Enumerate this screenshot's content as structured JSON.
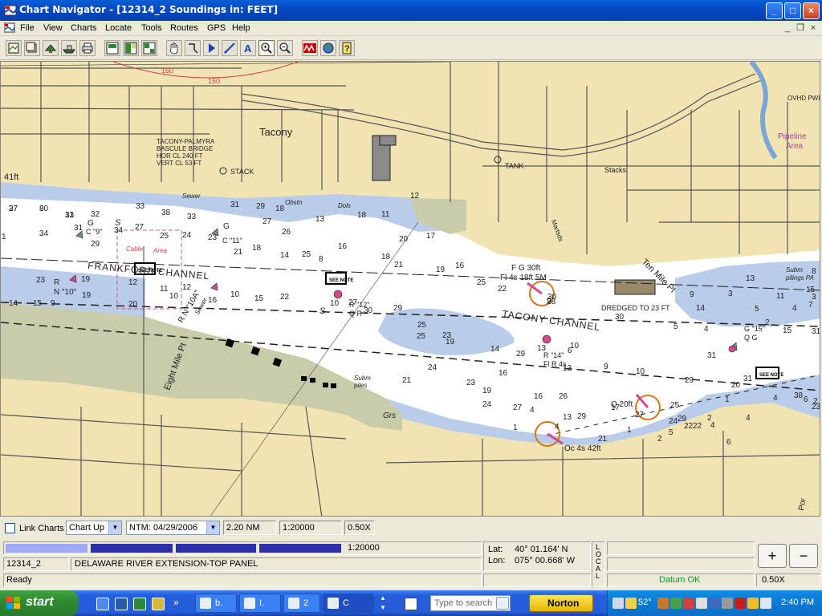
{
  "window": {
    "title": "Chart Navigator - [12314_2 Soundings in: FEET]",
    "min_label": "_",
    "max_label": "□",
    "close_label": "×"
  },
  "menu": {
    "items": [
      "File",
      "View",
      "Charts",
      "Locate",
      "Tools",
      "Routes",
      "GPS",
      "Help"
    ],
    "mdi_min": "_",
    "mdi_restore": "❐",
    "mdi_close": "×"
  },
  "toolbar": {
    "buttons": [
      "open-chart-icon",
      "chart-catalog-icon",
      "chart-info-icon",
      "ship-icon",
      "print-icon",
      "overview-icon",
      "split-view-icon",
      "grid-icon",
      "pan-hand-icon",
      "zoom-box-icon",
      "waypoint-icon",
      "route-line-icon",
      "text-tool-icon",
      "zoom-in-icon",
      "zoom-out-icon",
      "tide-icon",
      "web-icon",
      "help-icon"
    ],
    "pressed": "zoom-in-icon"
  },
  "map": {
    "soundings": [
      {
        "t": "27"
      },
      {
        "t": "30"
      },
      {
        "t": "31"
      },
      {
        "t": "32"
      },
      {
        "t": "33"
      },
      {
        "t": "38"
      },
      {
        "t": "33"
      },
      {
        "t": "31"
      },
      {
        "t": "29"
      },
      {
        "t": "18"
      },
      {
        "t": "13"
      },
      {
        "t": "18"
      },
      {
        "t": "11"
      },
      {
        "t": "12"
      },
      {
        "t": "1"
      },
      {
        "t": "34"
      },
      {
        "t": "31"
      },
      {
        "t": "29"
      },
      {
        "t": "34"
      },
      {
        "t": "27"
      },
      {
        "t": "25"
      },
      {
        "t": "24"
      },
      {
        "t": "23"
      },
      {
        "t": "21"
      },
      {
        "t": "27"
      },
      {
        "t": "26"
      },
      {
        "t": "25"
      },
      {
        "t": "18"
      },
      {
        "t": "14"
      },
      {
        "t": "8"
      },
      {
        "t": "16"
      },
      {
        "t": "18"
      },
      {
        "t": "20"
      },
      {
        "t": "17"
      },
      {
        "t": "21"
      },
      {
        "t": "19"
      },
      {
        "t": "16"
      },
      {
        "t": "25"
      },
      {
        "t": "22"
      },
      {
        "t": "23"
      },
      {
        "t": "19"
      },
      {
        "t": "15"
      },
      {
        "t": "14"
      },
      {
        "t": "9"
      },
      {
        "t": "19"
      },
      {
        "t": "20"
      },
      {
        "t": "12"
      },
      {
        "t": "10"
      },
      {
        "t": "11"
      },
      {
        "t": "12"
      },
      {
        "t": "16"
      },
      {
        "t": "10"
      },
      {
        "t": "15"
      },
      {
        "t": "22"
      },
      {
        "t": "10"
      },
      {
        "t": "27"
      },
      {
        "t": "30"
      },
      {
        "t": "29"
      },
      {
        "t": "25"
      },
      {
        "t": "25"
      },
      {
        "t": "23"
      },
      {
        "t": "19"
      },
      {
        "t": "14"
      },
      {
        "t": "29"
      },
      {
        "t": "16"
      },
      {
        "t": "13"
      },
      {
        "t": "10"
      },
      {
        "t": "13"
      },
      {
        "t": "9"
      },
      {
        "t": "10"
      },
      {
        "t": "17"
      },
      {
        "t": "16"
      },
      {
        "t": "19"
      },
      {
        "t": "21"
      },
      {
        "t": "24"
      },
      {
        "t": "23"
      },
      {
        "t": "24"
      },
      {
        "t": "27"
      },
      {
        "t": "26"
      },
      {
        "t": "29"
      },
      {
        "t": "21"
      },
      {
        "t": "27"
      },
      {
        "t": "25"
      },
      {
        "t": "24"
      },
      {
        "t": "22"
      },
      {
        "t": "2"
      },
      {
        "t": "1"
      },
      {
        "t": "4"
      },
      {
        "t": "4"
      },
      {
        "t": "6"
      },
      {
        "t": "2"
      },
      {
        "t": "23"
      },
      {
        "t": "1"
      },
      {
        "t": "4"
      },
      {
        "t": "2"
      },
      {
        "t": "5"
      },
      {
        "t": "4"
      },
      {
        "t": "28"
      },
      {
        "t": "30"
      },
      {
        "t": "30"
      },
      {
        "t": "5"
      },
      {
        "t": "4"
      },
      {
        "t": "31"
      },
      {
        "t": "20"
      },
      {
        "t": "15"
      },
      {
        "t": "31"
      },
      {
        "t": "29"
      },
      {
        "t": "31"
      },
      {
        "t": "38"
      },
      {
        "t": "29"
      },
      {
        "t": "22"
      },
      {
        "t": "6"
      },
      {
        "t": "13"
      },
      {
        "t": "8"
      },
      {
        "t": "9"
      },
      {
        "t": "3"
      },
      {
        "t": "5"
      },
      {
        "t": "2"
      },
      {
        "t": "11"
      },
      {
        "t": "15"
      },
      {
        "t": "7"
      },
      {
        "t": "3"
      },
      {
        "t": "4"
      },
      {
        "t": "14"
      },
      {
        "t": "13"
      },
      {
        "t": "1"
      },
      {
        "t": "6"
      },
      {
        "t": "9"
      },
      {
        "t": "4"
      },
      {
        "t": "37"
      },
      {
        "t": "8"
      },
      {
        "t": "13"
      }
    ],
    "labels": {
      "tacony": "Tacony",
      "bridge1": "TACONY-PALMYRA",
      "bridge2": "BASCULE BRIDGE",
      "bridge3": "HOR CL 240 FT",
      "bridge4": "VERT CL 53 FT",
      "stack": "STACK",
      "tank": "TANK",
      "stacks": "Stacks",
      "pipeline1": "Pipeline",
      "pipeline2": "Area",
      "ovhd": "OVHD PWR",
      "depth41": "41ft",
      "frankford": "FRANKFORD CHANNEL",
      "tacony_channel": "TACONY CHANNEL",
      "ten_mile": "Ten Mile Pt",
      "eight_mile": "Eight Mile Pt",
      "dredged": "DREDGED TO 23 FT",
      "cable1": "Cable",
      "cable2": "Area",
      "sewer1": "Sewer",
      "sewer2": "Sewer",
      "obstn": "Obstn",
      "dols": "Dols",
      "martsds": "Martsds",
      "subm_pilings1": "Subm",
      "subm_pilings2": "pilings PA",
      "subm_piles1": "Subm",
      "subm_piles2": "piles",
      "grs": "Grs",
      "por": "Por",
      "s1": "S",
      "s2": "S",
      "g9a": "G",
      "g9b": "C \"9\"",
      "g11a": "G",
      "g11b": "C \"11\"",
      "rn10a": "R",
      "rn10b": "N \"10\"",
      "rn10a2": "R N \"10A\"",
      "r12a": "R \"12\"",
      "r12b": "Q R",
      "r14a": "R \"14\"",
      "r14b": "Fl R 4s",
      "fg30": "F G 30ft",
      "fl4s": "Fl 4s 18ft 5M",
      "q20": "Q 20ft",
      "oc4s": "Oc 4s 42ft",
      "g15a": "G \"15\"",
      "g15b": "Q G",
      "see_note": "SEE NOTE",
      "deg150": "150",
      "deg160": "160"
    }
  },
  "chartbar": {
    "link_charts": "Link Charts",
    "orientation": "Chart Up",
    "ntm": "NTM: 04/29/2006",
    "range": "2.20 NM",
    "scale": "1:20000",
    "zoom": "0.50X"
  },
  "status": {
    "scale_label": "1:20000",
    "chart_id": "12314_2",
    "chart_name": "DELAWARE RIVER EXTENSION-TOP PANEL",
    "lat_label": "Lat:",
    "lat": "40° 01.164' N",
    "lon_label": "Lon:",
    "lon": "075° 00.668' W",
    "local": "LOCAL",
    "datum": "Datum OK",
    "zoom_in": "+",
    "zoom_out": "−",
    "zoom2": "0.50X",
    "ready": "Ready"
  },
  "taskbar": {
    "start": "start",
    "tasks": [
      "b.",
      "I.",
      "2",
      "C"
    ],
    "search_placeholder": "Type to search",
    "norton": "Norton",
    "temp": "52°",
    "clock": "2:40 PM",
    "colors": {
      "bar": "#245edb",
      "start": "#2e8b2e",
      "tray": "#0c7fd8"
    }
  }
}
